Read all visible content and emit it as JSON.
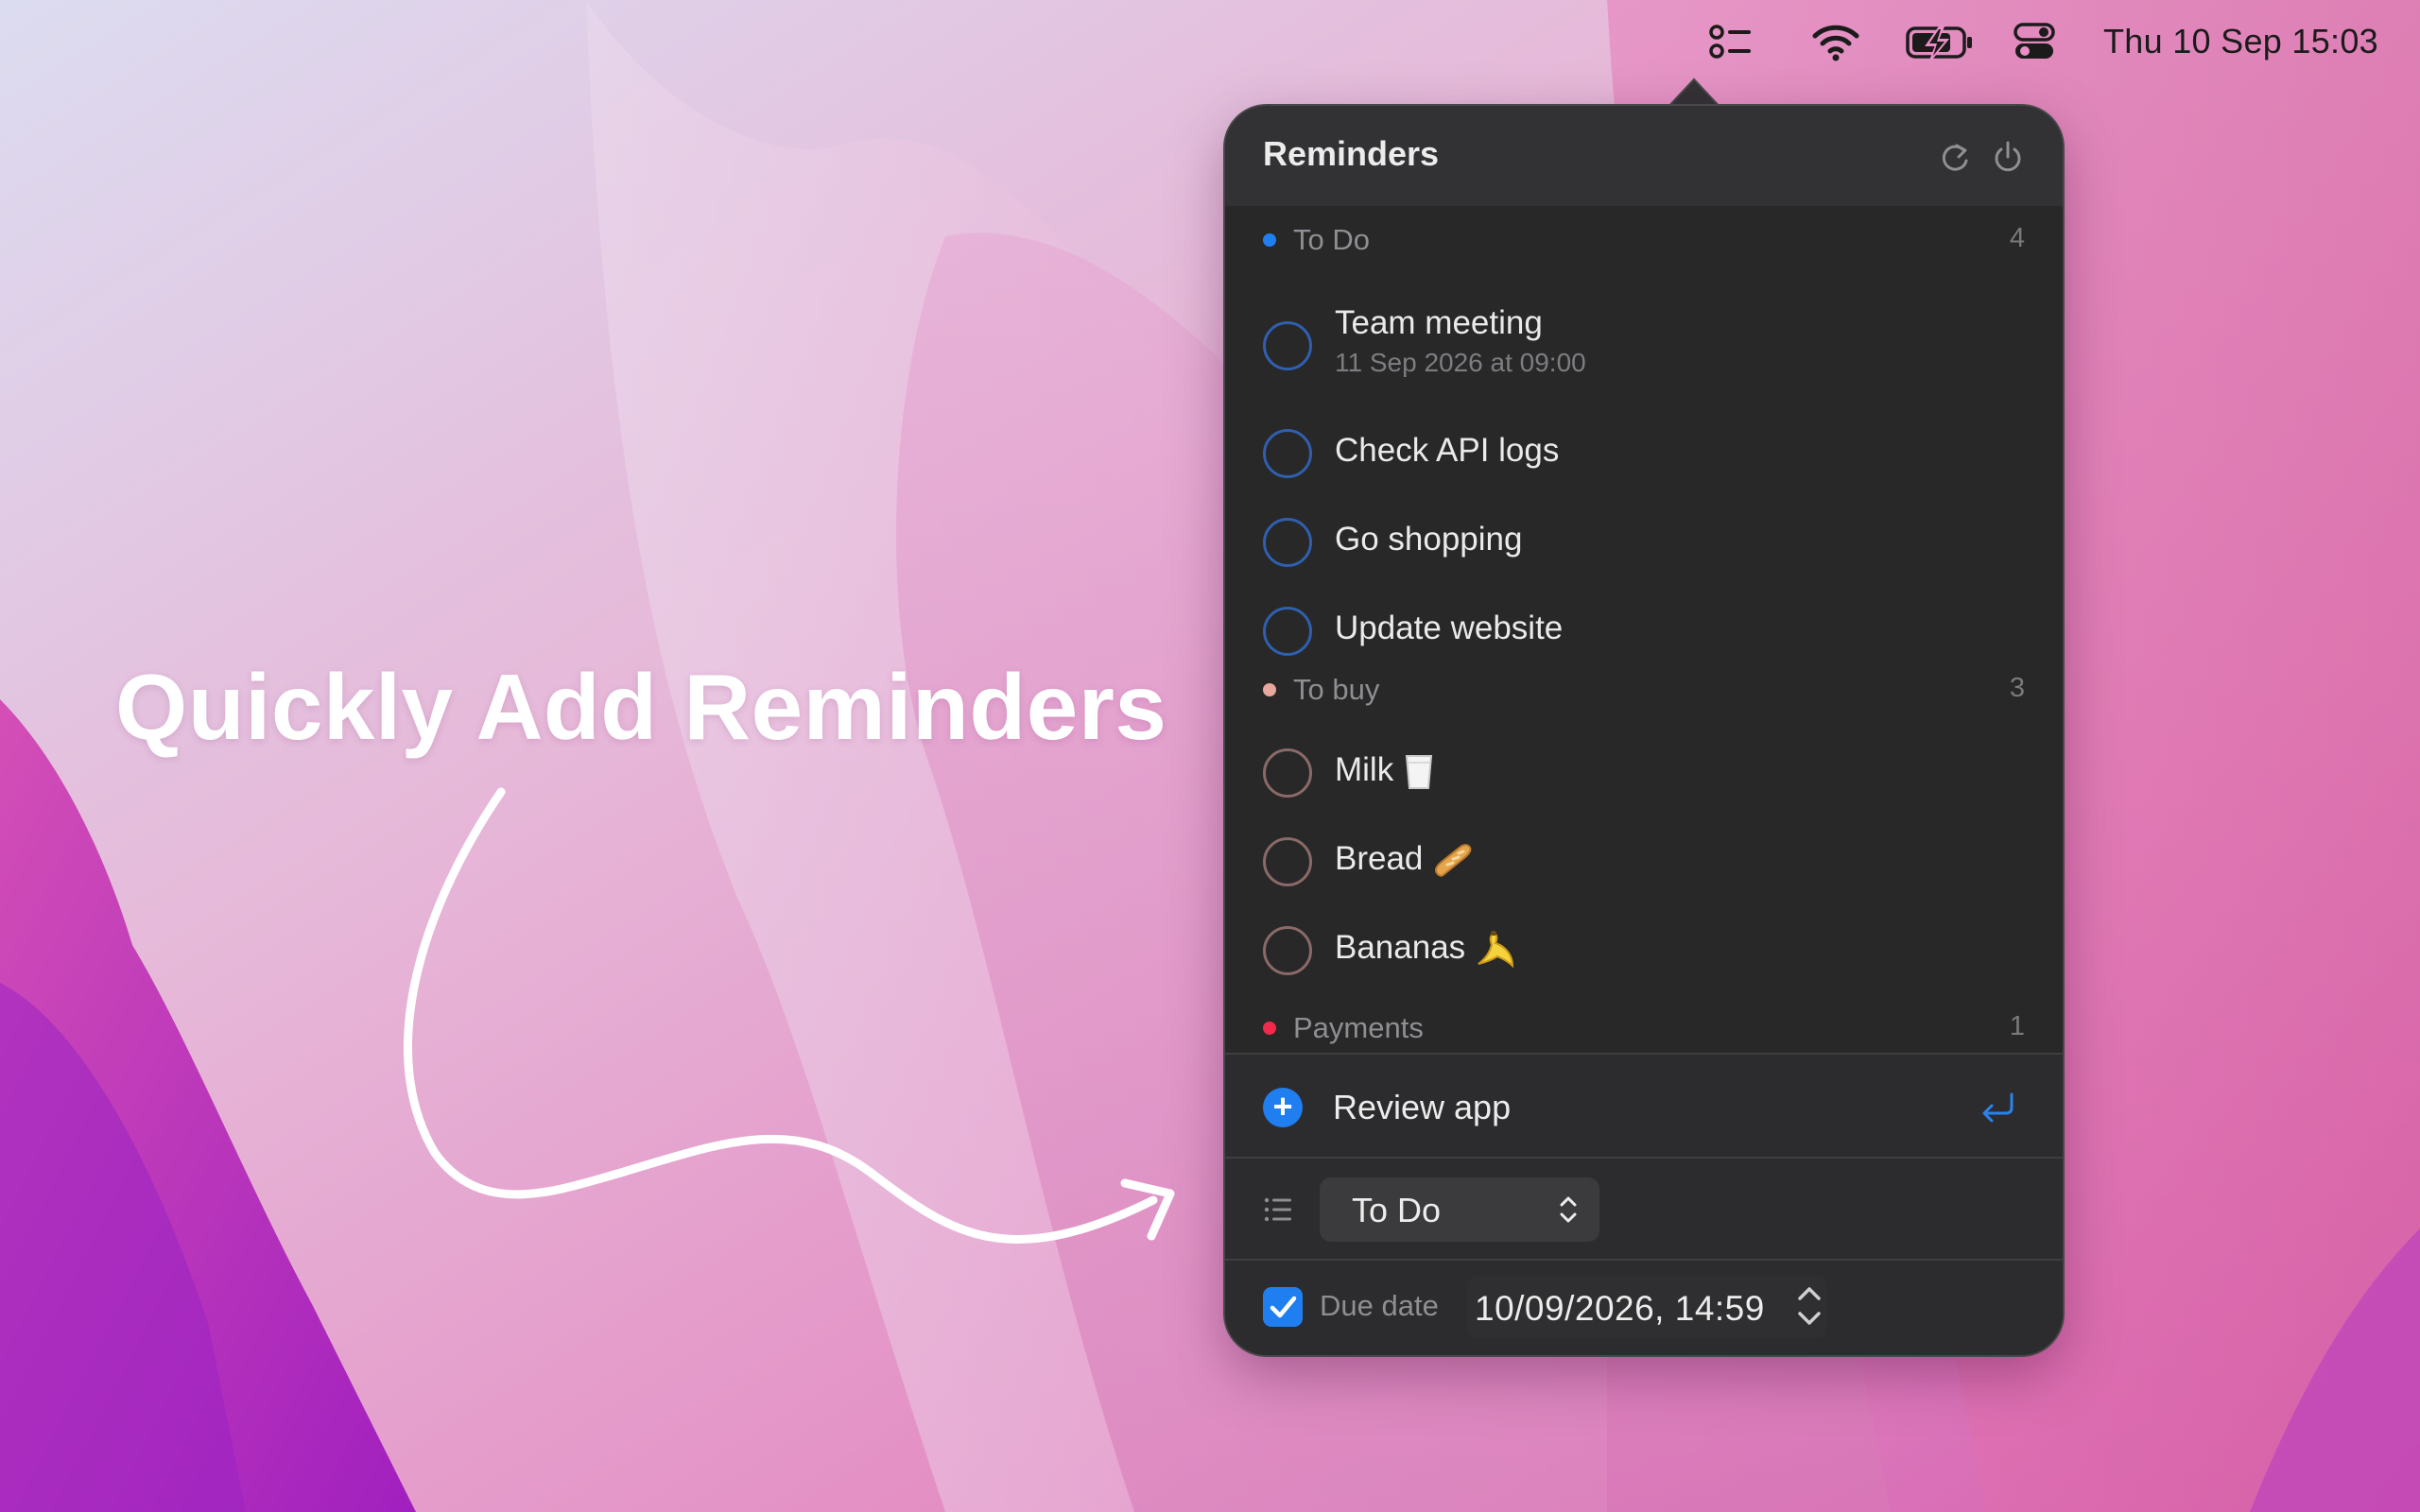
{
  "menubar": {
    "icons": [
      "checklist-icon",
      "wifi-icon",
      "battery-charging-icon",
      "control-center-icon"
    ],
    "clock": "Thu 10 Sep  15:03"
  },
  "hero": {
    "text": "Quickly Add Reminders"
  },
  "popover": {
    "title": "Reminders",
    "header_buttons": [
      "refresh-icon",
      "power-icon"
    ],
    "sections": [
      {
        "name": "To Do",
        "count": "4",
        "color": "#1f7ff0",
        "items": [
          {
            "title": "Team meeting",
            "subtitle": "11 Sep 2026 at 09:00"
          },
          {
            "title": "Check API logs"
          },
          {
            "title": "Go shopping"
          },
          {
            "title": "Update website"
          }
        ]
      },
      {
        "name": "To buy",
        "count": "3",
        "color": "#e8a79c",
        "items": [
          {
            "title": "Milk",
            "emoji": "milk-glass"
          },
          {
            "title": "Bread",
            "emoji": "baguette"
          },
          {
            "title": "Bananas",
            "emoji": "banana"
          }
        ]
      },
      {
        "name": "Payments",
        "count": "1",
        "color": "#f2294a",
        "items": []
      }
    ],
    "new_reminder": {
      "value": "Review app"
    },
    "list_picker": {
      "selected": "To Do"
    },
    "due_date": {
      "label": "Due date",
      "checked": true,
      "value": "10/09/2026, 14:59"
    }
  },
  "colors": {
    "accent": "#1f7ff0",
    "popover_bg": "#282828",
    "header_bg": "#323234"
  }
}
